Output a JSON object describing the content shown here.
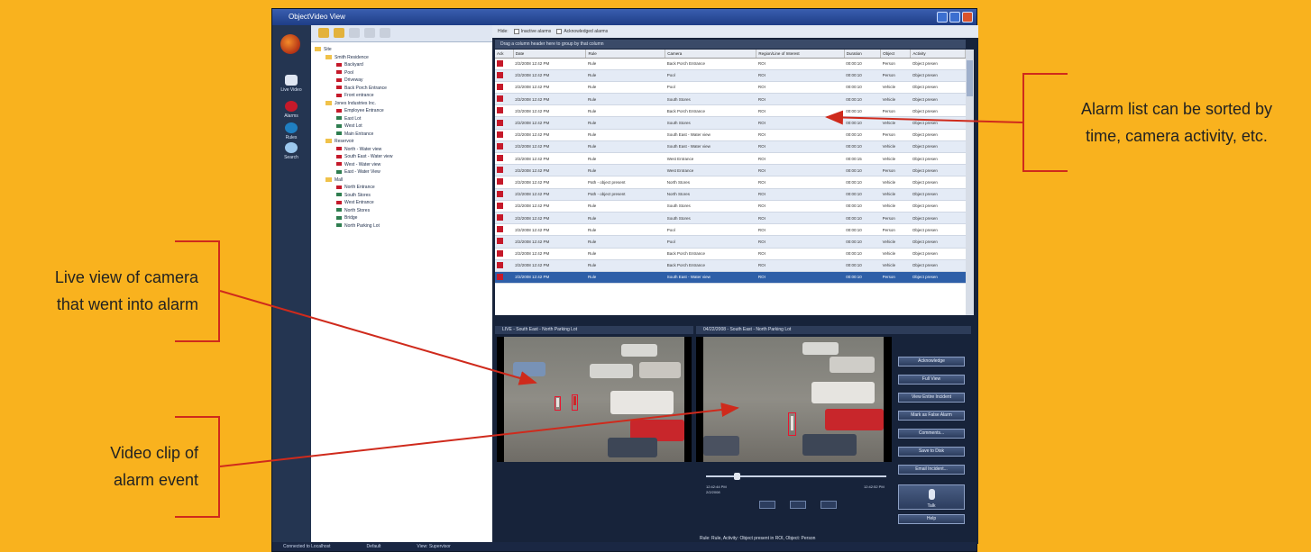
{
  "window": {
    "title": "ObjectVideo View"
  },
  "nav": {
    "items": [
      {
        "label": "Live Video"
      },
      {
        "label": "Alarms"
      },
      {
        "label": "Rules"
      },
      {
        "label": "Search"
      }
    ]
  },
  "tree": {
    "items": [
      {
        "label": "Site",
        "level": 0,
        "type": "folder"
      },
      {
        "label": "Smith Residence",
        "level": 1,
        "type": "folder"
      },
      {
        "label": "Backyard",
        "level": 2,
        "color": "#c5192a"
      },
      {
        "label": "Pool",
        "level": 2,
        "color": "#c5192a"
      },
      {
        "label": "Driveway",
        "level": 2,
        "color": "#c5192a"
      },
      {
        "label": "Back Porch Entrance",
        "level": 2,
        "color": "#c5192a"
      },
      {
        "label": "Front entrance",
        "level": 2,
        "color": "#c5192a"
      },
      {
        "label": "Jones Industries Inc.",
        "level": 1,
        "type": "folder"
      },
      {
        "label": "Employee Entrance",
        "level": 2,
        "color": "#c5192a"
      },
      {
        "label": "East Lot",
        "level": 2,
        "color": "#2e7d4f"
      },
      {
        "label": "West Lot",
        "level": 2,
        "color": "#2e7d4f"
      },
      {
        "label": "Main Entrance",
        "level": 2,
        "color": "#2e7d4f"
      },
      {
        "label": "Reservoir",
        "level": 1,
        "type": "folder"
      },
      {
        "label": "North - Water view",
        "level": 2,
        "color": "#c5192a"
      },
      {
        "label": "South East - Water view",
        "level": 2,
        "color": "#c5192a"
      },
      {
        "label": "West - Water view",
        "level": 2,
        "color": "#c5192a"
      },
      {
        "label": "East - Water View",
        "level": 2,
        "color": "#2e7d4f"
      },
      {
        "label": "Mall",
        "level": 1,
        "type": "folder"
      },
      {
        "label": "North Entrance",
        "level": 2,
        "color": "#c5192a"
      },
      {
        "label": "South Stores",
        "level": 2,
        "color": "#2e7d4f"
      },
      {
        "label": "West Entrance",
        "level": 2,
        "color": "#c5192a"
      },
      {
        "label": "North Stores",
        "level": 2,
        "color": "#2e7d4f"
      },
      {
        "label": "Bridge",
        "level": 2,
        "color": "#2e7d4f"
      },
      {
        "label": "North Parking Lot",
        "level": 2,
        "color": "#2e7d4f"
      }
    ]
  },
  "filter": {
    "label": "Hide:",
    "option1": "Inactive alarms",
    "option2": "Acknowledged alarms"
  },
  "grid": {
    "group_hint": "Drag a column header here to group by that column",
    "columns": [
      "Ack",
      "Date",
      "Rule",
      "Camera",
      "Region/Line of Interest",
      "Duration",
      "Object",
      "Activity"
    ],
    "rows": [
      [
        "2/2/2008 12:42 PM",
        "Rule",
        "Back Porch Entrance",
        "ROI",
        "00:00:10",
        "Person",
        "Object presen"
      ],
      [
        "2/2/2008 12:42 PM",
        "Rule",
        "Pool",
        "ROI",
        "00:00:10",
        "Person",
        "Object presen"
      ],
      [
        "2/2/2008 12:42 PM",
        "Rule",
        "Pool",
        "ROI",
        "00:00:10",
        "Vehicle",
        "Object presen"
      ],
      [
        "2/2/2008 12:42 PM",
        "Rule",
        "South Stores",
        "ROI",
        "00:00:10",
        "Vehicle",
        "Object presen"
      ],
      [
        "2/2/2008 12:42 PM",
        "Rule",
        "Back Porch Entrance",
        "ROI",
        "00:00:10",
        "Person",
        "Object presen"
      ],
      [
        "2/2/2008 12:42 PM",
        "Rule",
        "South Stores",
        "ROI",
        "00:00:10",
        "Vehicle",
        "Object presen"
      ],
      [
        "2/2/2008 12:42 PM",
        "Rule",
        "South East - Water view",
        "ROI",
        "00:00:10",
        "Person",
        "Object presen"
      ],
      [
        "2/2/2008 12:42 PM",
        "Rule",
        "South East - Water view",
        "ROI",
        "00:00:10",
        "Vehicle",
        "Object presen"
      ],
      [
        "2/2/2008 12:42 PM",
        "Rule",
        "West Entrance",
        "ROI",
        "00:00:15",
        "Vehicle",
        "Object presen"
      ],
      [
        "2/2/2008 12:42 PM",
        "Rule",
        "West Entrance",
        "ROI",
        "00:00:10",
        "Person",
        "Object presen"
      ],
      [
        "2/2/2008 12:42 PM",
        "Path - object present",
        "North Stores",
        "ROI",
        "00:00:10",
        "Vehicle",
        "Object presen"
      ],
      [
        "2/2/2008 12:42 PM",
        "Path - object present",
        "North Stores",
        "ROI",
        "00:00:10",
        "Vehicle",
        "Object presen"
      ],
      [
        "2/2/2008 12:42 PM",
        "Rule",
        "South Stores",
        "ROI",
        "00:00:10",
        "Vehicle",
        "Object presen"
      ],
      [
        "2/2/2008 12:42 PM",
        "Rule",
        "South Stores",
        "ROI",
        "00:00:10",
        "Person",
        "Object presen"
      ],
      [
        "2/2/2008 12:42 PM",
        "Rule",
        "Pool",
        "ROI",
        "00:00:10",
        "Person",
        "Object presen"
      ],
      [
        "2/2/2008 12:42 PM",
        "Rule",
        "Pool",
        "ROI",
        "00:00:10",
        "Vehicle",
        "Object presen"
      ],
      [
        "2/2/2008 12:42 PM",
        "Rule",
        "Back Porch Entrance",
        "ROI",
        "00:00:10",
        "Vehicle",
        "Object presen"
      ],
      [
        "2/2/2008 12:42 PM",
        "Rule",
        "Back Porch Entrance",
        "ROI",
        "00:00:10",
        "Vehicle",
        "Object presen"
      ],
      [
        "2/2/2008 12:42 PM",
        "Rule",
        "South East - Water view",
        "ROI",
        "00:00:10",
        "Person",
        "Object presen"
      ]
    ]
  },
  "video": {
    "live_title": "LIVE - South East - North Parking Lot",
    "clip_title": "04/22/2008 - South East - North Parking Lot",
    "clip_start": "12:42:44 PM",
    "clip_start_date": "2/2/2008",
    "clip_end": "12:42:52 PM",
    "caption": "Rule: Rule, Activity: Object present in ROI, Object: Person"
  },
  "side_buttons": [
    "Acknowledge",
    "Full View",
    "View Entire Incident",
    "Mark as False Alarm",
    "Comments...",
    "Save to Disk",
    "Email Incident...",
    "Talk",
    "Help"
  ],
  "status": {
    "connection": "Connected to Localhost",
    "user": "Default",
    "view": "View: Supervisor"
  },
  "callouts": {
    "alarm_list_line1": "Alarm list can be sorted by",
    "alarm_list_line2": "time, camera activity, etc.",
    "live_line1": "Live view of camera",
    "live_line2": "that went into alarm",
    "clip_line1": "Video clip of",
    "clip_line2": "alarm event"
  },
  "colors": {
    "background": "#f9b21e",
    "arrow": "#cf2a1c",
    "alarm_red": "#c5192a"
  }
}
